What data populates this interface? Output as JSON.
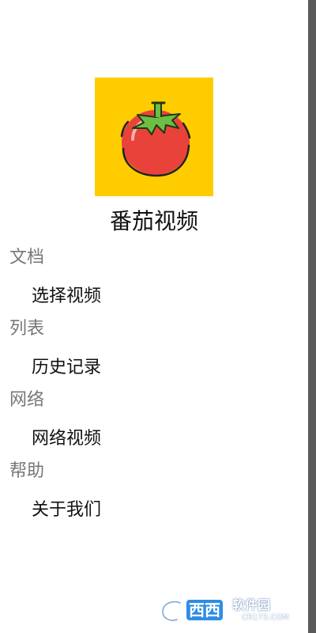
{
  "app": {
    "name": "番茄视频",
    "logo_icon": "tomato-icon",
    "logo_bg": "#FFCC00"
  },
  "sections": [
    {
      "header": "文档",
      "item": "选择视频"
    },
    {
      "header": "列表",
      "item": "历史记录"
    },
    {
      "header": "网络",
      "item": "网络视频"
    },
    {
      "header": "帮助",
      "item": "关于我们"
    }
  ],
  "watermark": {
    "brand": "西西",
    "site": "软件园",
    "domain": "CR173.COM"
  }
}
